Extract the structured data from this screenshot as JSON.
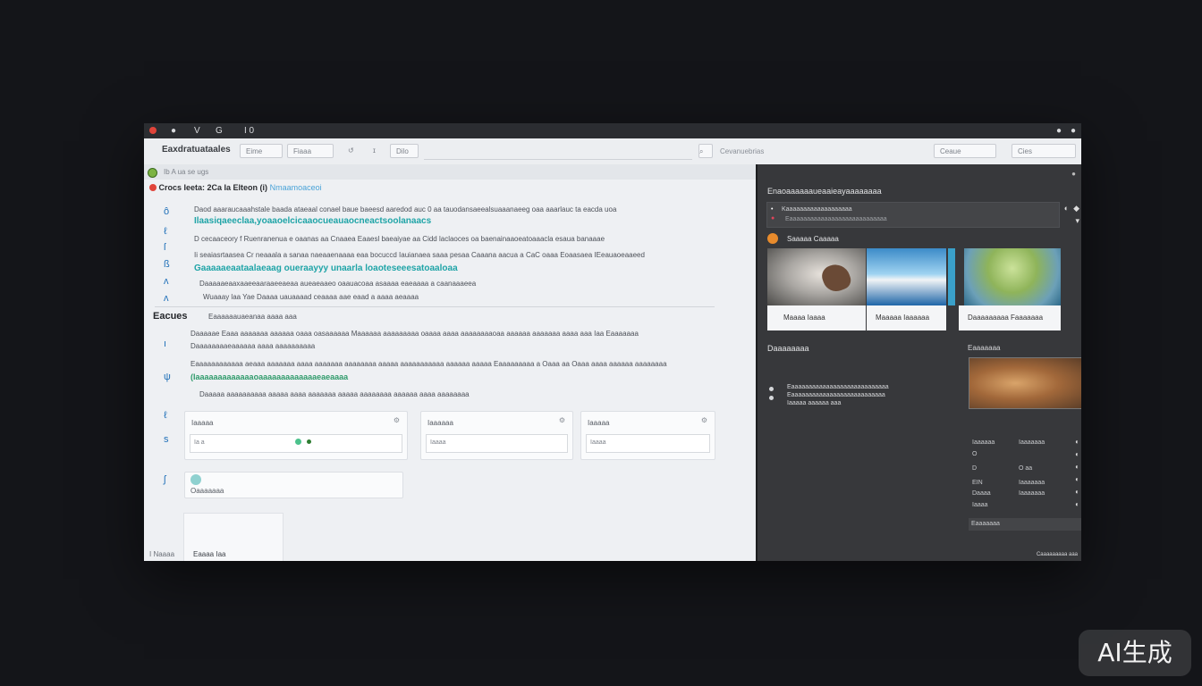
{
  "titlebar": {
    "items": [
      "●",
      "V",
      "G",
      "I 0"
    ]
  },
  "toolbar": {
    "app_title": "Eaxdratuataales",
    "btn_1": "Eime",
    "btn_2": "Fiaaa",
    "btn_3": "Dilo",
    "search_placeholder": "Cevanuebrias",
    "btn_right_1": "Ceaue",
    "btn_right_2": "Cies"
  },
  "subbar": {
    "text": "Ib A ua se ugs"
  },
  "main": {
    "heading": "Crocs Ieeta: 2Ca Ia Elteon (i)",
    "heading_link": "Nmaamoaceoi",
    "lines": [
      "Daod aaaraucaaahstale baada ataeaal conael baue baeesd aaredod auc 0 aa  tauodansaeealsuaaanaeeg oaa aaarlauc ta eacda uoa",
      "Ilaasiqaeeclaa,yoaaoelcicaaocueauaocneactsoolanaacs",
      "D cecaaceory f Ruenranenua e oaanas  aa Cnaaea  Eaaesl baeaiyae aa Cidd  laclaoces oa  baenainaaoeatoaaacla esaua banaaae",
      "Ii seaiasrtaasea  Cr  neaaala a sanaa naeaaenaaaa eaa bocuccd Iauianaea saaa  pesaa  Caaana  aacua  a  CaC oaaa Eoaasaea IEeauaoeaaeed",
      "Gaaaaaeaataalaeaag oueraayyy unaarla loaoteseeesatoaaloaa",
      "Daaaaaeaaxaaeeaaraaeeaeaa  aueaeaaeo oaauacoaa  asaaaa eaeaaaa  a  caanaaaeea",
      "Wuaaay  laa  Yae Daaaa uauaaaad ceaaaa aae eaad a aaaa aeaaaa"
    ],
    "section_title": "Eacues",
    "section_sub": "Eaaaaaauaeanaa aaaa aaa",
    "section_lines": [
      "Daaaaae  Eaaa aaaaaaa  aaaaaa oaaa  oasaaaaaa  Maaaaaa  aaaaaaaaa  oaaaa aaaa  aaaaaaaaoaa  aaaaaa aaaaaaa  aaaa aaa Iaa Eaaaaaaa",
      "Daaaaaaaaeaaaaaa  aaaa aaaaaaaaaa",
      "Eaaaaaaaaaaaa aeaaa aaaaaaa aaaa aaaaaaa  aaaaaaaa  aaaaa  aaaaaaaaaaa aaaaaa  aaaaa Eaaaaaaaaa a  Oaaa aa  Oaaa aaaa aaaaaa aaaaaaaa",
      "(Iaaaaaaaaaaaaaoaaaaaaaaaaaaaeaeaaaa",
      "Daaaaa aaaaaaaaaa aaaaa aaaa aaaaaaa  aaaaa aaaaaaaa aaaaaa aaaa aaaaaaaa"
    ],
    "cards": [
      {
        "label": "Iaaaaa",
        "field": "Ia a"
      },
      {
        "label": "Iaaaaaa",
        "field": "Iaaaa"
      },
      {
        "label": "Iaaaaa",
        "field": "Iaaaa"
      }
    ],
    "bottom_card": "Oaaaaaaa",
    "footer_left": "I Naaaa",
    "footer_tab": "Eaaaa Iaa"
  },
  "right_panel": {
    "title": "Enaoaaaaaaueaaieayaaaaaaaa",
    "box_line_1": "Kaaaaaaaaaaaaaaaaaaa",
    "box_line_2": "Eaaaaaaaaaaaaaaaaaaaaaaaaaaaa",
    "item_label": "Saaaaa Caaaaa",
    "captions": [
      "Maaaa Iaaaa",
      "Maaaaa Iaaaaaa",
      "Daaaaaaaaa Faaaaaaa"
    ],
    "note_label": "Daaaaaaaa",
    "note_lines": [
      "Eaaaaaaaaaaaaaaaaaaaaaaaaaaaa",
      "Eaaaaaaaaaaaaaaaaaaaaaaaaaaa",
      "Iaaaaa aaaaaa aaa"
    ],
    "side_title": "Eaaaaaaa",
    "list_a": [
      "Iaaaaaa",
      "O",
      "D",
      "EIN",
      "Daaaa",
      "Iaaaa"
    ],
    "list_b": [
      "Iaaaaaaa",
      "",
      "O aa",
      "",
      "Iaaaaaaa",
      "Iaaaaaaa"
    ],
    "side_footer": "Eaaaaaaa",
    "status": "Caaaaaaaaa aaa"
  },
  "overlay": {
    "watermark": "AI生成"
  },
  "colors": {
    "accent_teal": "#1fa4a7",
    "accent_green": "#2e9a6a",
    "orange": "#e88b2c",
    "dark_panel": "#37383b"
  }
}
